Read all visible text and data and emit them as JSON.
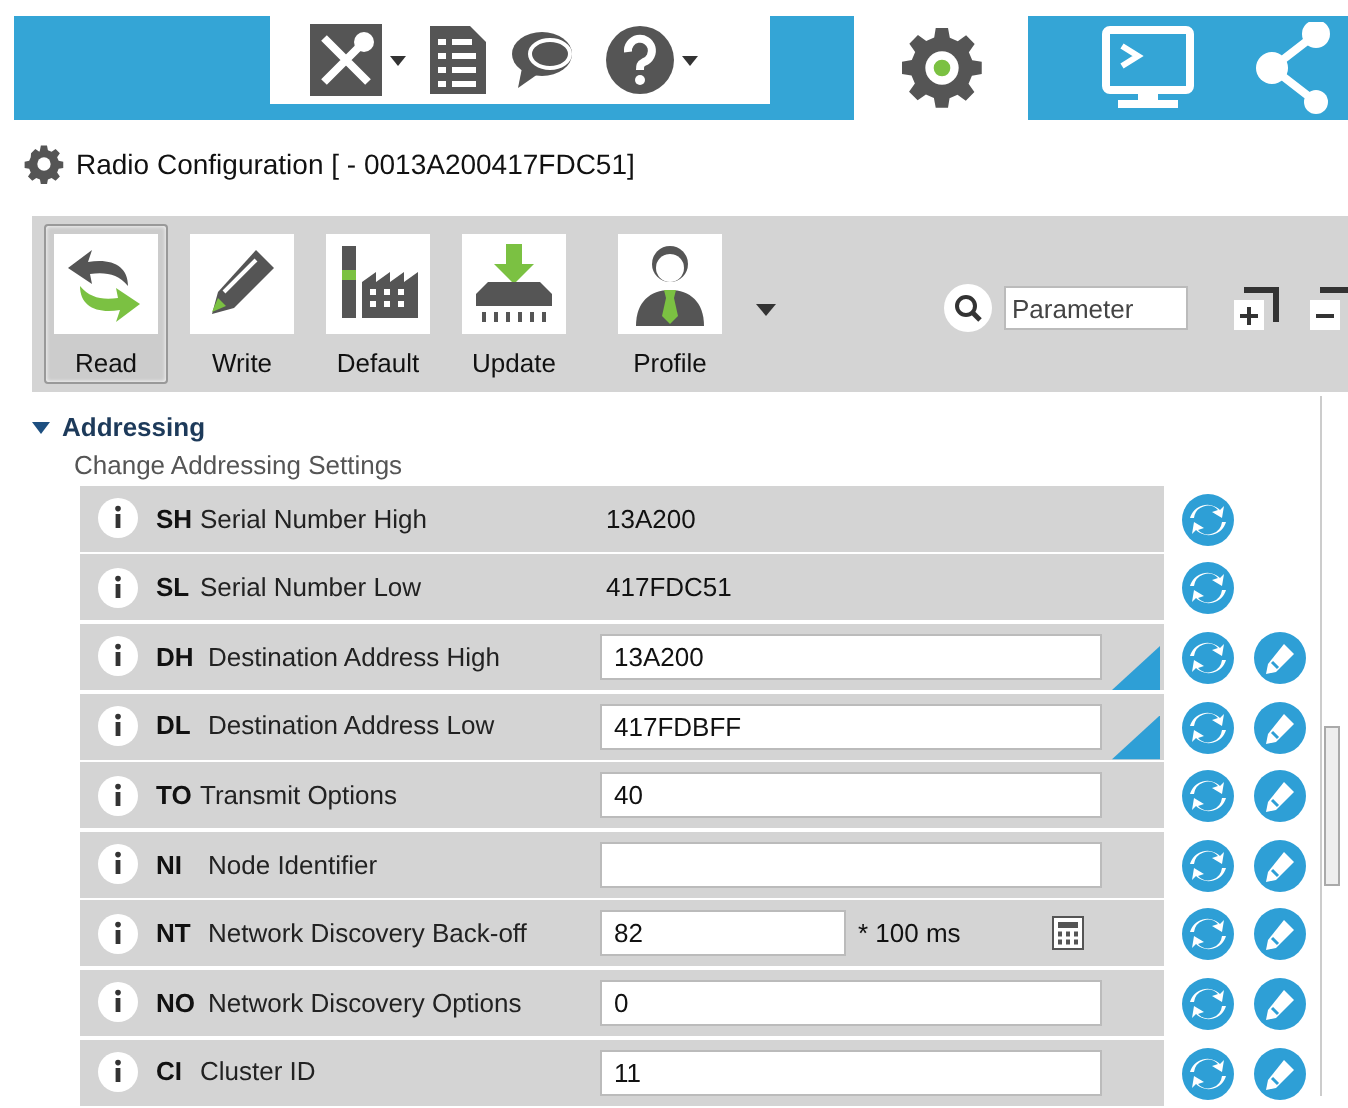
{
  "title_bar": {
    "title": "Radio Configuration [  - 0013A200417FDC51]"
  },
  "top_tabs": [
    {
      "kind": "tools",
      "selected": false
    },
    {
      "kind": "config",
      "selected": true
    },
    {
      "kind": "console",
      "selected": false
    },
    {
      "kind": "network",
      "selected": false
    }
  ],
  "toolbar": {
    "buttons": [
      {
        "kind": "read",
        "label": "Read",
        "selected": true
      },
      {
        "kind": "write",
        "label": "Write",
        "selected": false
      },
      {
        "kind": "default",
        "label": "Default",
        "selected": false
      },
      {
        "kind": "update",
        "label": "Update",
        "selected": false
      },
      {
        "kind": "profile",
        "label": "Profile",
        "selected": false
      }
    ],
    "search": {
      "placeholder": "Parameter"
    }
  },
  "section": {
    "title": "Addressing",
    "subtitle": "Change Addressing Settings",
    "expanded": true,
    "rows": [
      {
        "kind": "readonly",
        "code": "SH",
        "name": "Serial Number High",
        "value": "13A200",
        "changed": false
      },
      {
        "kind": "readonly",
        "code": "SL",
        "name": "Serial Number Low",
        "value": "417FDC51",
        "changed": false
      },
      {
        "kind": "field",
        "code": "DH",
        "name": "Destination Address High",
        "value": "13A200",
        "changed": true
      },
      {
        "kind": "field",
        "code": "DL",
        "name": "Destination Address Low",
        "value": "417FDBFF",
        "changed": true
      },
      {
        "kind": "field",
        "code": "TO",
        "name": "Transmit Options",
        "value": "40",
        "changed": false
      },
      {
        "kind": "field",
        "code": "NI",
        "name": "Node Identifier",
        "value": "",
        "changed": false
      },
      {
        "kind": "calc",
        "code": "NT",
        "name": "Network Discovery Back-off",
        "value": "82",
        "unit": "* 100 ms",
        "changed": false
      },
      {
        "kind": "field",
        "code": "NO",
        "name": "Network Discovery Options",
        "value": "0",
        "changed": false
      },
      {
        "kind": "field",
        "code": "CI",
        "name": "Cluster ID",
        "value": "11",
        "changed": false
      }
    ]
  }
}
